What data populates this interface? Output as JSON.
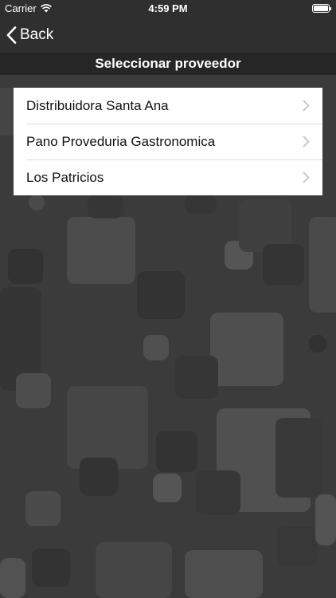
{
  "status_bar": {
    "carrier": "Carrier",
    "time": "4:59 PM",
    "battery_level": 1.0
  },
  "nav": {
    "back_label": "Back"
  },
  "header": {
    "title": "Seleccionar proveedor"
  },
  "suppliers": [
    {
      "label": "Distribuidora Santa Ana"
    },
    {
      "label": "Pano Proveduria Gastronomica"
    },
    {
      "label": "Los Patricios"
    }
  ],
  "colors": {
    "background": "#3b3b3b",
    "bar": "#2f2f2f",
    "title_bar": "#262626",
    "list_background": "#ffffff",
    "chevron": "#c4c4c7"
  },
  "icons": {
    "wifi": "wifi-icon",
    "battery": "battery-icon",
    "back": "chevron-left-icon",
    "row_disclosure": "chevron-right-icon"
  }
}
